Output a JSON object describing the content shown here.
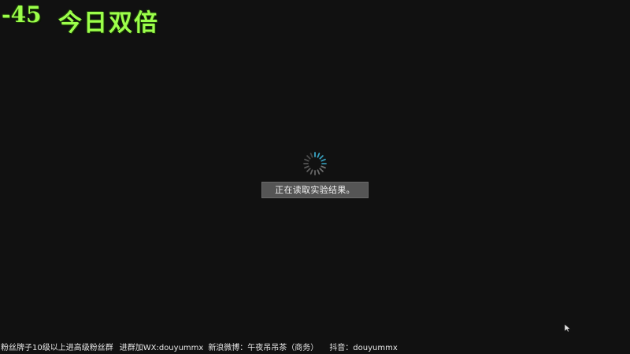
{
  "overlay": {
    "score": "-45",
    "title": "今日双倍"
  },
  "loading": {
    "message": "正在读取实验结果。",
    "spinner_color": "#3aa8c8"
  },
  "footer": {
    "fan_group": "粉丝牌子10级以上进高级粉丝群",
    "wechat": "进群加WX:douyummx",
    "weibo": "新浪微博：午夜吊吊茶（商务）",
    "douyin": "抖音：douyummx"
  },
  "icons": {
    "cursor": "mouse-pointer-icon",
    "spinner": "loading-spinner-icon"
  }
}
